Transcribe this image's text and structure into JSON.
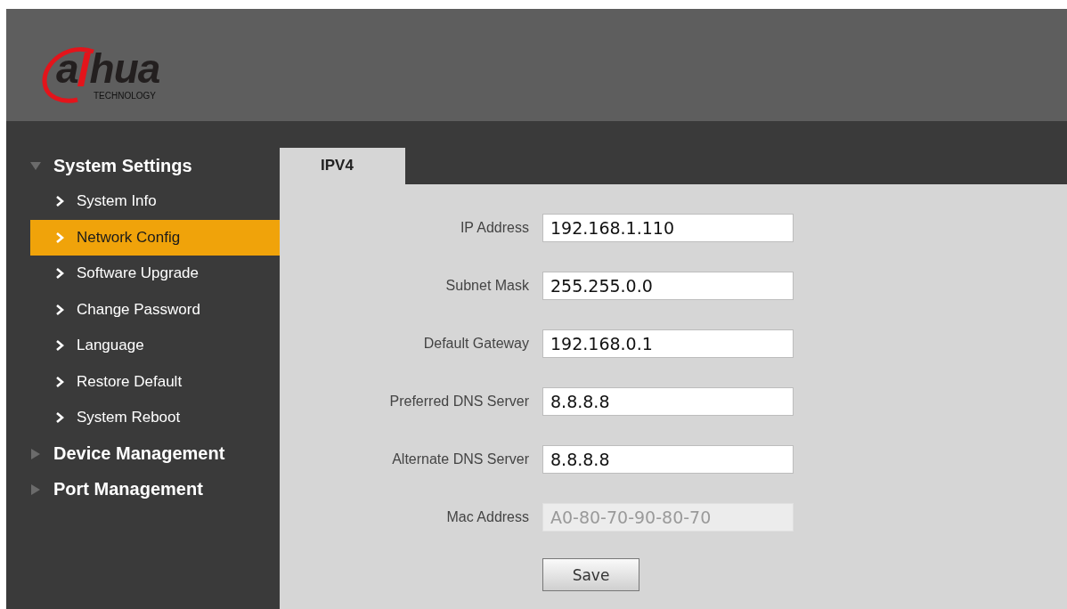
{
  "header": {
    "logo": {
      "left": "a",
      "right": "hua",
      "tagline": "TECHNOLOGY"
    }
  },
  "sidebar": {
    "groups": [
      {
        "label": "System Settings",
        "expanded": true,
        "children": [
          {
            "label": "System Info",
            "selected": false
          },
          {
            "label": "Network Config",
            "selected": true
          },
          {
            "label": "Software Upgrade",
            "selected": false
          },
          {
            "label": "Change Password",
            "selected": false
          },
          {
            "label": "Language",
            "selected": false
          },
          {
            "label": "Restore Default",
            "selected": false
          },
          {
            "label": "System Reboot",
            "selected": false
          }
        ]
      },
      {
        "label": "Device Management",
        "expanded": false
      },
      {
        "label": "Port Management",
        "expanded": false
      }
    ]
  },
  "tabs": [
    {
      "label": "IPV4",
      "selected": true
    }
  ],
  "fields": [
    {
      "label": "IP Address",
      "value": "192.168.1.110",
      "disabled": false
    },
    {
      "label": "Subnet Mask",
      "value": "255.255.0.0",
      "disabled": false
    },
    {
      "label": "Default Gateway",
      "value": "192.168.0.1",
      "disabled": false
    },
    {
      "label": "Preferred DNS Server",
      "value": "8.8.8.8",
      "disabled": false
    },
    {
      "label": "Alternate DNS Server",
      "value": "8.8.8.8",
      "disabled": false
    },
    {
      "label": "Mac Address",
      "value": "A0-80-70-90-80-70",
      "disabled": true
    }
  ],
  "save_button": "Save"
}
